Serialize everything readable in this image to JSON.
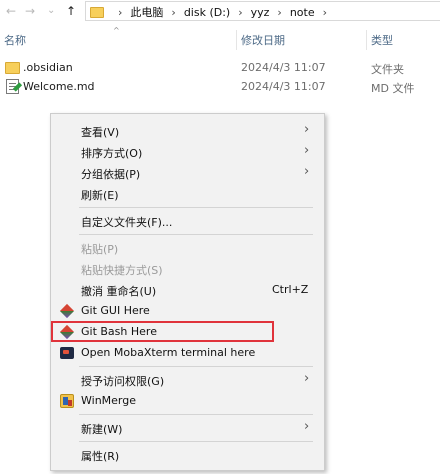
{
  "breadcrumb": {
    "back": "←",
    "forward": "→",
    "recent": "⌄",
    "up": "↑",
    "items": [
      "此电脑",
      "disk (D:)",
      "yyz",
      "note"
    ],
    "separator": "›"
  },
  "columns": {
    "name": "名称",
    "sort_caret": "^",
    "modified": "修改日期",
    "type": "类型"
  },
  "files": [
    {
      "name": ".obsidian",
      "date": "2024/4/3 11:07",
      "type": "文件夹",
      "icon": "folder-icon"
    },
    {
      "name": "Welcome.md",
      "date": "2024/4/3 11:07",
      "type": "MD 文件",
      "icon": "markdown-file-icon"
    }
  ],
  "context_menu": {
    "arrow": "›",
    "items": {
      "view": "查看(V)",
      "sort_by": "排序方式(O)",
      "group_by": "分组依据(P)",
      "refresh": "刷新(E)",
      "customize": "自定义文件夹(F)...",
      "paste": "粘贴(P)",
      "paste_shortcut": "粘贴快捷方式(S)",
      "undo_rename": "撤消 重命名(U)",
      "undo_shortcut": "Ctrl+Z",
      "git_gui": "Git GUI Here",
      "git_bash": "Git Bash Here",
      "mobaxterm": "Open MobaXterm terminal here",
      "give_access": "授予访问权限(G)",
      "winmerge": "WinMerge",
      "new": "新建(W)",
      "properties": "属性(R)"
    }
  },
  "colors": {
    "highlight_border": "#e0333b",
    "menu_background": "#f2f2f2"
  }
}
